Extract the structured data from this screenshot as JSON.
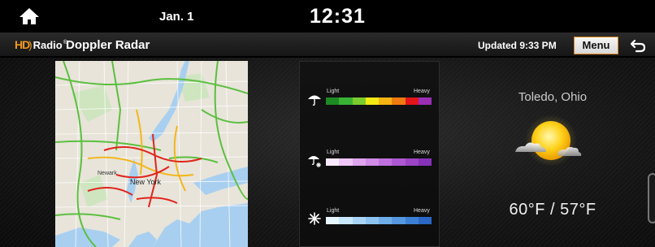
{
  "status_bar": {
    "date": "Jan. 1",
    "time": "12:31"
  },
  "header": {
    "logo_hd": "HD",
    "logo_radio": "Radio",
    "logo_reg": "®",
    "title": "Doppler Radar",
    "updated": "Updated 9:33 PM",
    "menu_label": "Menu"
  },
  "map": {
    "labels": [
      "New York",
      "Newark"
    ]
  },
  "legend": {
    "rows": [
      {
        "type": "rain",
        "icon": "umbrella-icon",
        "light": "Light",
        "heavy": "Heavy",
        "colors": [
          "#1e8a24",
          "#38b334",
          "#7ccc2e",
          "#f2ea13",
          "#f5b414",
          "#f07b10",
          "#e3151a",
          "#9a2fb4"
        ]
      },
      {
        "type": "mix",
        "icon": "umbrella-snow-icon",
        "light": "Light",
        "heavy": "Heavy",
        "colors": [
          "#fbeaff",
          "#edc6f6",
          "#dfa4ee",
          "#d18ae6",
          "#c070de",
          "#ad58d2",
          "#9b44c6",
          "#8632b8"
        ]
      },
      {
        "type": "snow",
        "icon": "snowflake-icon",
        "light": "Light",
        "heavy": "Heavy",
        "colors": [
          "#e8f6ff",
          "#c8e7fb",
          "#a8d5f6",
          "#8cc3f0",
          "#6eaee9",
          "#5698e0",
          "#3c80d4",
          "#2a67c6"
        ]
      }
    ]
  },
  "weather": {
    "city": "Toledo, Ohio",
    "temps": "60°F / 57°F",
    "icon": "partly-cloudy-icon"
  },
  "colors": {
    "accent": "#f29a1f",
    "menu_border": "#d9821a"
  }
}
